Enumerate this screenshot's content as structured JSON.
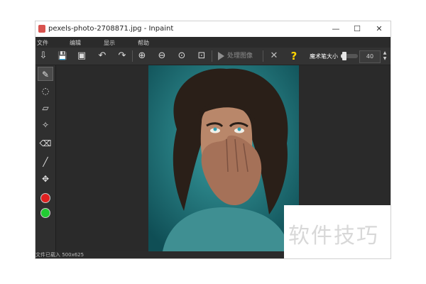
{
  "window": {
    "title": "pexels-photo-2708871.jpg - Inpaint",
    "controls": {
      "minimize": "—",
      "maximize": "☐",
      "close": "✕"
    }
  },
  "menu": [
    "文件",
    "编辑",
    "显示",
    "帮助"
  ],
  "toolbar": {
    "process_label": "处理图像",
    "help_glyph": "?",
    "brush_size_label": "魔术笔大小",
    "brush_size_value": "40",
    "brush_size_level": 0.2
  },
  "tool_glyphs": {
    "open": "⇩",
    "save": "💾",
    "save_as": "▣",
    "undo": "↶",
    "redo": "↷",
    "zoom_in": "⊕",
    "zoom_out": "⊖",
    "actual_size": "⊙",
    "fit": "⊡",
    "clear": "✕",
    "marker": "✎",
    "lasso": "◌",
    "polygon": "▱",
    "magic_wand": "✧",
    "eraser": "⌫",
    "line": "╱",
    "move": "✥"
  },
  "colors": {
    "app_icon": "#d9534f",
    "red_swatch": "#e02020",
    "green_swatch": "#22cc33",
    "help": "#ffd400",
    "clear": "#bcbcbc",
    "photo_bg": "#1f6f74"
  },
  "status": "文件已载入 500x625",
  "watermark": "软件技巧"
}
